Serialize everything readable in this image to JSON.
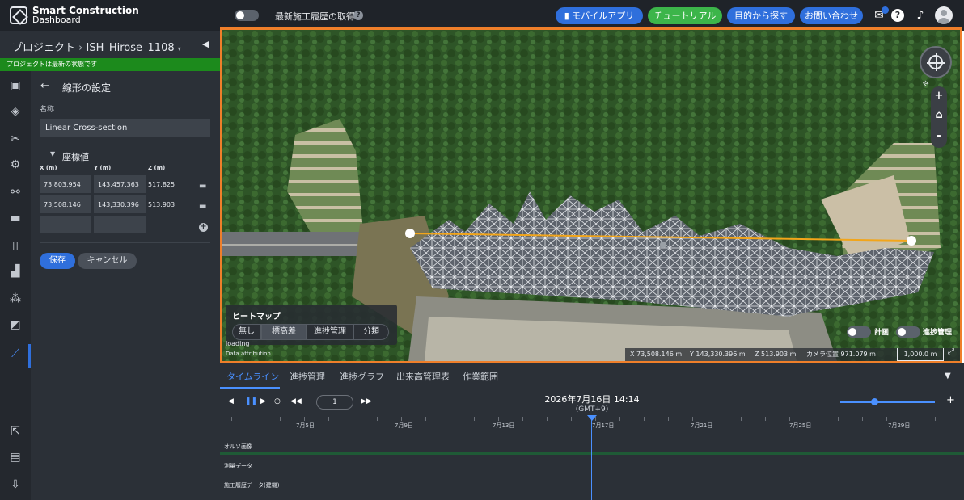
{
  "app": {
    "logo_line1": "Smart Construction",
    "logo_line2": "Dashboard"
  },
  "topbar": {
    "history_toggle_label": "最新施工履歴の取得",
    "buttons": [
      {
        "label": "モバイルアプリ",
        "color": "#2f6fdc"
      },
      {
        "label": "チュートリアル",
        "color": "#3cb54a"
      },
      {
        "label": "目的から探す",
        "color": "#2f6fdc"
      },
      {
        "label": "お問い合わせ",
        "color": "#2f6fdc"
      }
    ]
  },
  "project": {
    "breadcrumb_root": "プロジェクト",
    "separator": "›",
    "project_name": "ISH_Hirose_1108",
    "status": "プロジェクトは最新の状態です"
  },
  "form": {
    "title": "線形の設定",
    "name_label": "名称",
    "name_value": "Linear Cross-section",
    "coords_title": "座標値",
    "col_x": "X (m)",
    "col_y": "Y (m)",
    "col_z": "Z (m)",
    "rows": [
      {
        "x": "73,803.954",
        "y": "143,457.363",
        "z": "517.825"
      },
      {
        "x": "73,508.146",
        "y": "143,330.396",
        "z": "513.903"
      }
    ],
    "save_label": "保存",
    "cancel_label": "キャンセル"
  },
  "map": {
    "heatmap_title": "ヒートマップ",
    "heatmap_options": [
      "無し",
      "標高差",
      "進捗管理",
      "分類"
    ],
    "heatmap_selected": "標高差",
    "loading": "loading",
    "attribution": "Data attribution",
    "plan_label": "計画",
    "progress_label": "進捗管理",
    "north": "N",
    "coords": {
      "x": "X 73,508.146 m",
      "y": "Y 143,330.396 m",
      "z": "Z 513.903 m",
      "camera": "カメラ位置 971.079 m",
      "scale": "1,000.0 m"
    }
  },
  "timeline": {
    "tabs": [
      "タイムライン",
      "進捗管理",
      "進捗グラフ",
      "出来高管理表",
      "作業範囲"
    ],
    "active_tab": "タイムライン",
    "speed": "1",
    "date": "2026年7月16日 14:14",
    "timezone": "(GMT+9)",
    "dates": [
      "7月5日",
      "7月9日",
      "7月13日",
      "7月17日",
      "7月21日",
      "7月25日",
      "7月29日"
    ],
    "rows": [
      "オルソ画像",
      "測量データ",
      "施工履歴データ(建機)"
    ]
  }
}
